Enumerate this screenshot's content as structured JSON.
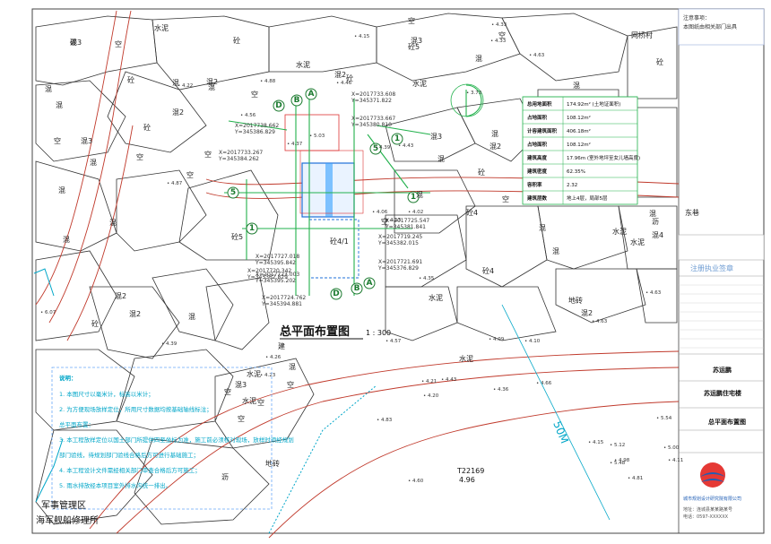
{
  "drawing": {
    "title": "总平面布置图",
    "scale": "1 : 300",
    "distance_label": "50M",
    "road_code": "T22169",
    "road_elev": "4.96"
  },
  "top_right_notes": [
    "注意事项：",
    "本图纸由相关部门出具"
  ],
  "area_labels": [
    "混3",
    "空",
    "水泥",
    "砼",
    "混",
    "空",
    "混3",
    "砼5",
    "混",
    "空",
    "混2",
    "混",
    "混",
    "混",
    "砼",
    "砼",
    "混2",
    "空",
    "空",
    "水泥",
    "混2",
    "砼",
    "混3",
    "混",
    "空",
    "砼5",
    "混",
    "空",
    "混",
    "混",
    "混2",
    "砼4",
    "空",
    "砼4/1",
    "水泥",
    "砼4",
    "混",
    "混",
    "混3",
    "混2",
    "混",
    "空",
    "水泥",
    "砼",
    "空",
    "砼",
    "混",
    "空",
    "混",
    "混",
    "混2",
    "水泥",
    "混",
    "混4",
    "混",
    "空",
    "砼",
    "空",
    "混",
    "水泥",
    "混2",
    "混",
    "砼",
    "水泥",
    "混3",
    "空",
    "网桥村",
    "砼",
    "东巷",
    "水泥",
    "沥",
    "地砖",
    "混2",
    "空",
    "空",
    "建",
    "混",
    "水泥",
    "空",
    "地砖",
    "沥",
    "砖"
  ],
  "elevations": [
    "4.15",
    "4.33",
    "4.63",
    "4.46",
    "4.22",
    "4.88",
    "4.56",
    "5.03",
    "4.39",
    "4.37",
    "4.87",
    "4.43",
    "4.02",
    "4.13",
    "4.06",
    "4.35",
    "3.73",
    "4.33",
    "6.07",
    "4.83",
    "4.26",
    "4.23",
    "4.57",
    "4.63",
    "4.21",
    "4.66",
    "4.43",
    "4.36",
    "4.10",
    "4.09",
    "4.15",
    "4.11",
    "4.98",
    "4.20",
    "4.60",
    "5.12",
    "5.48",
    "4.81",
    "5.54",
    "5.00",
    "4.39",
    "4.63"
  ],
  "axis_labels": [
    "A",
    "B",
    "D",
    "A",
    "B",
    "D",
    "1",
    "5",
    "1",
    "5",
    "1"
  ],
  "coords": [
    "X=2017733.608",
    "Y=345371.822",
    "X=2017733.667",
    "Y=345380.810",
    "X=2017738.662",
    "Y=345386.829",
    "X=2017733.267",
    "Y=345384.262",
    "X=2017725.547",
    "Y=345381.841",
    "X=2017721.691",
    "Y=345376.829",
    "X=2017727.018",
    "Y=345395.842",
    "X=2017723.003",
    "Y=345395.202",
    "X=2017724.762",
    "Y=345394.881",
    "X=2017719.245",
    "Y=345382.015",
    "X=2017720.342",
    "Y=345362.829"
  ],
  "stats_table": {
    "rows": [
      [
        "总用地面积",
        "174.92m² (土地证面积)"
      ],
      [
        "占地面积",
        "108.12m²"
      ],
      [
        "计容建筑面积",
        "406.18m²"
      ],
      [
        "占地面积",
        "108.12m²"
      ],
      [
        "建筑高度",
        "17.96m (室外地坪至女儿墙高度)"
      ],
      [
        "建筑密度",
        "62.35%"
      ],
      [
        "容积率",
        "2.32"
      ],
      [
        "建筑层数",
        "地上4层，局部5层"
      ]
    ]
  },
  "notes": {
    "heading": "说明：",
    "items": [
      "1. 本图尺寸以毫米计，标高以米计；",
      "2. 为方便现场放样定位，所用尺寸数据均按基础轴线标注；",
      "   总平面布置：",
      "3. 本工程放样定位以国土部门所提供四至坐标为准，施工前必须核对现场，放样时须经规划",
      "   部门验线，待规划部门验线合格后方可进行基础施工；",
      "4. 本工程设计文件需经相关部门审查合格后方可施工；",
      "5. 雨水排放经本项目室外排水沟统一排出。"
    ]
  },
  "bottom_left": {
    "line1": "军事管理区",
    "line2": "海军舰船修理所"
  },
  "title_block": {
    "stamp_label": "注册执业签章",
    "rows": [
      "",
      "",
      "",
      "",
      "",
      "",
      "",
      ""
    ],
    "owner": "苏运鹏",
    "project": "苏运鹏住宅楼",
    "sheet_name": "总平面布置图",
    "company": "城市规划设计研究院有限公司",
    "address": "地址：连城县某某路某号",
    "phone": "电话：0597-XXXXXX"
  },
  "colors": {
    "building_lines": "#333333",
    "axis_green": "#22b14c",
    "road_red": "#c0392b",
    "cyan_notes": "#00a6c8",
    "site_blue": "#1e6fd9"
  }
}
